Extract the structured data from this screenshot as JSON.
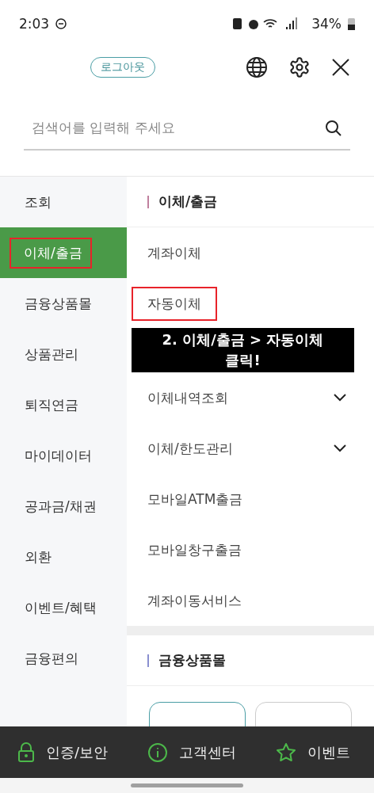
{
  "status_bar": {
    "time": "2:03",
    "battery": "34%"
  },
  "header": {
    "logout": "로그아웃"
  },
  "search": {
    "placeholder": "검색어를 입력해 주세요"
  },
  "categories": [
    {
      "label": "조회",
      "selected": false,
      "highlighted": false
    },
    {
      "label": "이체/출금",
      "selected": true,
      "highlighted": true
    },
    {
      "label": "금융상품몰",
      "selected": false,
      "highlighted": false
    },
    {
      "label": "상품관리",
      "selected": false,
      "highlighted": false
    },
    {
      "label": "퇴직연금",
      "selected": false,
      "highlighted": false
    },
    {
      "label": "마이데이터",
      "selected": false,
      "highlighted": false
    },
    {
      "label": "공과금/채권",
      "selected": false,
      "highlighted": false
    },
    {
      "label": "외환",
      "selected": false,
      "highlighted": false
    },
    {
      "label": "이벤트/혜택",
      "selected": false,
      "highlighted": false
    },
    {
      "label": "금융편의",
      "selected": false,
      "highlighted": false
    }
  ],
  "sections": [
    {
      "title": "이체/출금",
      "color": "#c0809e",
      "items": [
        {
          "label": "계좌이체",
          "expandable": false,
          "highlighted": false
        },
        {
          "label": "자동이체",
          "expandable": false,
          "highlighted": true
        },
        {
          "label": "이체내역조회",
          "expandable": true,
          "highlighted": false
        },
        {
          "label": "이체/한도관리",
          "expandable": true,
          "highlighted": false
        },
        {
          "label": "모바일ATM출금",
          "expandable": false,
          "highlighted": false
        },
        {
          "label": "모바일창구출금",
          "expandable": false,
          "highlighted": false
        },
        {
          "label": "계좌이동서비스",
          "expandable": false,
          "highlighted": false
        }
      ]
    },
    {
      "title": "금융상품몰",
      "color": "#8a8fd0",
      "cards": [
        {
          "selected": true
        },
        {
          "selected": false
        }
      ]
    }
  ],
  "annotation": {
    "line_1": "2. 이체/출금 > 자동이체",
    "line_2": "클릭!"
  },
  "bottom_nav": [
    {
      "kind": "lock",
      "label": "인증/보안"
    },
    {
      "kind": "info",
      "label": "고객센터"
    },
    {
      "kind": "star",
      "label": "이벤트"
    }
  ]
}
